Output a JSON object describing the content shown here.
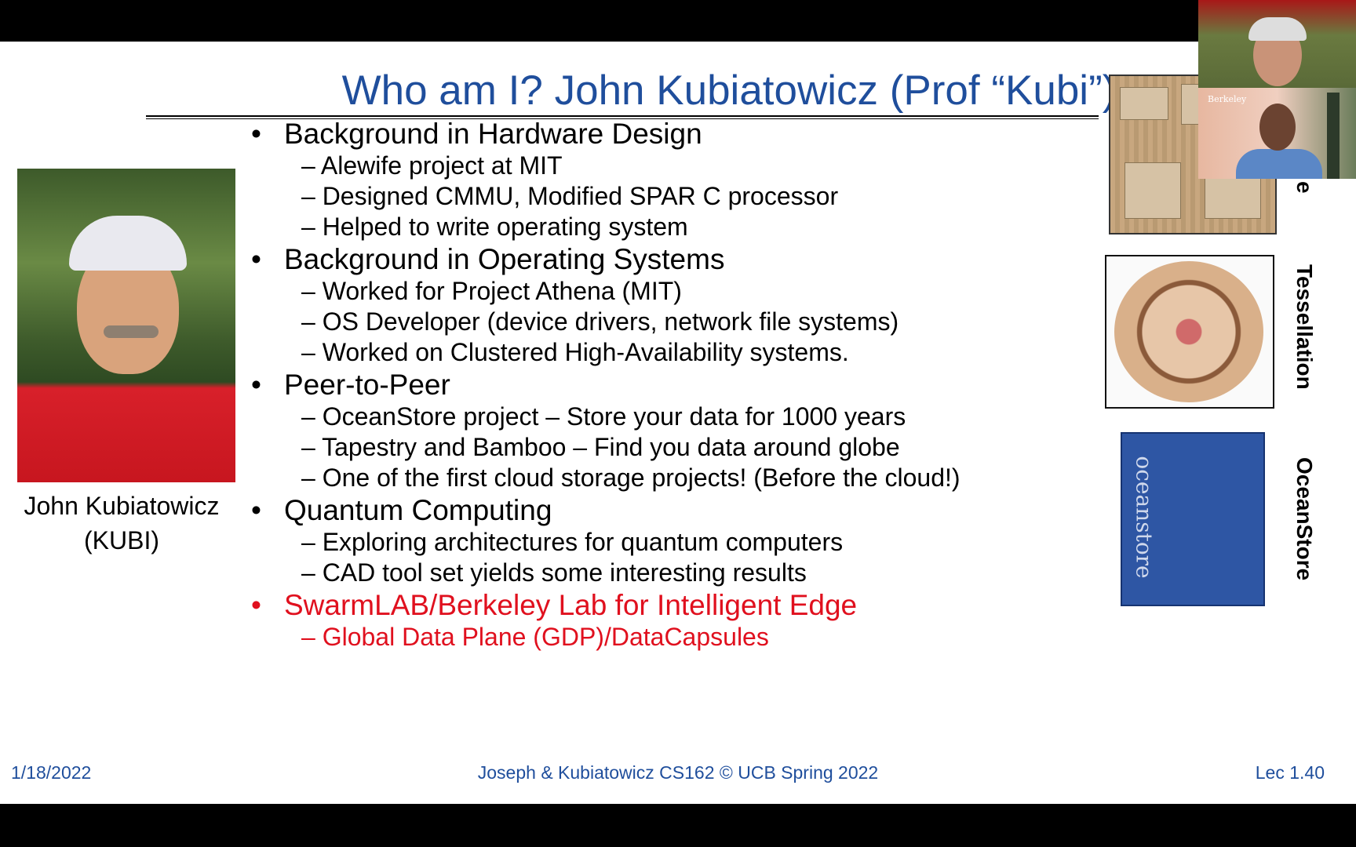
{
  "slide": {
    "title": "Who am I?  John Kubiatowicz (Prof “Kubi”)",
    "caption_line1": "John Kubiatowicz",
    "caption_line2": "(KUBI)",
    "sections": [
      {
        "label": "Background in Hardware Design",
        "items": [
          "Alewife project at MIT",
          "Designed CMMU, Modified SPAR C processor",
          "Helped to write operating system"
        ]
      },
      {
        "label": "Background in Operating Systems",
        "items": [
          "Worked for Project Athena (MIT)",
          "OS Developer (device drivers, network file systems)",
          "Worked on Clustered High-Availability systems."
        ]
      },
      {
        "label": "Peer-to-Peer",
        "items": [
          "OceanStore project – Store your data for 1000 years",
          "Tapestry and Bamboo – Find you data around globe",
          "One of the first cloud storage projects!  (Before the cloud!)"
        ]
      },
      {
        "label": "Quantum Computing",
        "items": [
          "Exploring architectures for quantum computers",
          "CAD tool set yields some interesting results"
        ]
      },
      {
        "label": "SwarmLAB/Berkeley Lab for Intelligent Edge",
        "items": [
          "Global Data Plane (GDP)/DataCapsules"
        ]
      }
    ],
    "bullet_glyph": "•",
    "dash_glyph": "–",
    "side_labels": {
      "chip_partial": "e",
      "tessellation": "Tessellation",
      "oceanstore": "OceanStore"
    },
    "ocean_logo_text": "oceanstore",
    "footer": {
      "date": "1/18/2022",
      "center": "Joseph & Kubiatowicz CS162 © UCB Spring 2022",
      "lec": "Lec 1.40"
    }
  },
  "video": {
    "tile2_tag": "Berkeley"
  },
  "colors": {
    "title_blue": "#1f4e9c",
    "highlight_red": "#e0101e"
  }
}
